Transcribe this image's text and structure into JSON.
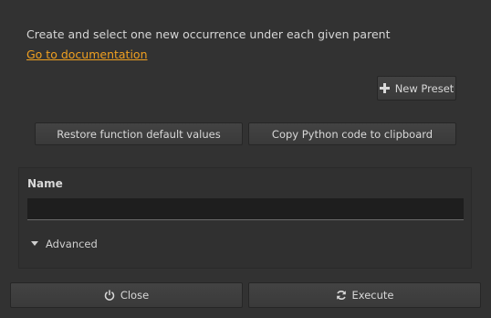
{
  "description": "Create and select one new occurrence under each given parent",
  "doc_link": "Go to documentation",
  "toolbar": {
    "new_preset_label": "New Preset",
    "new_preset_icon": "plus-icon"
  },
  "actions": {
    "restore_label": "Restore function default values",
    "copy_label": "Copy Python code to clipboard"
  },
  "form": {
    "name_label": "Name",
    "name_value": "",
    "advanced_label": "Advanced",
    "advanced_icon": "triangle-down-icon"
  },
  "footer": {
    "close_label": "Close",
    "close_icon": "power-icon",
    "execute_label": "Execute",
    "execute_icon": "refresh-icon"
  },
  "colors": {
    "background": "#323232",
    "link": "#f0a020",
    "button": "#3e3e3e",
    "input": "#1e1e1e"
  }
}
